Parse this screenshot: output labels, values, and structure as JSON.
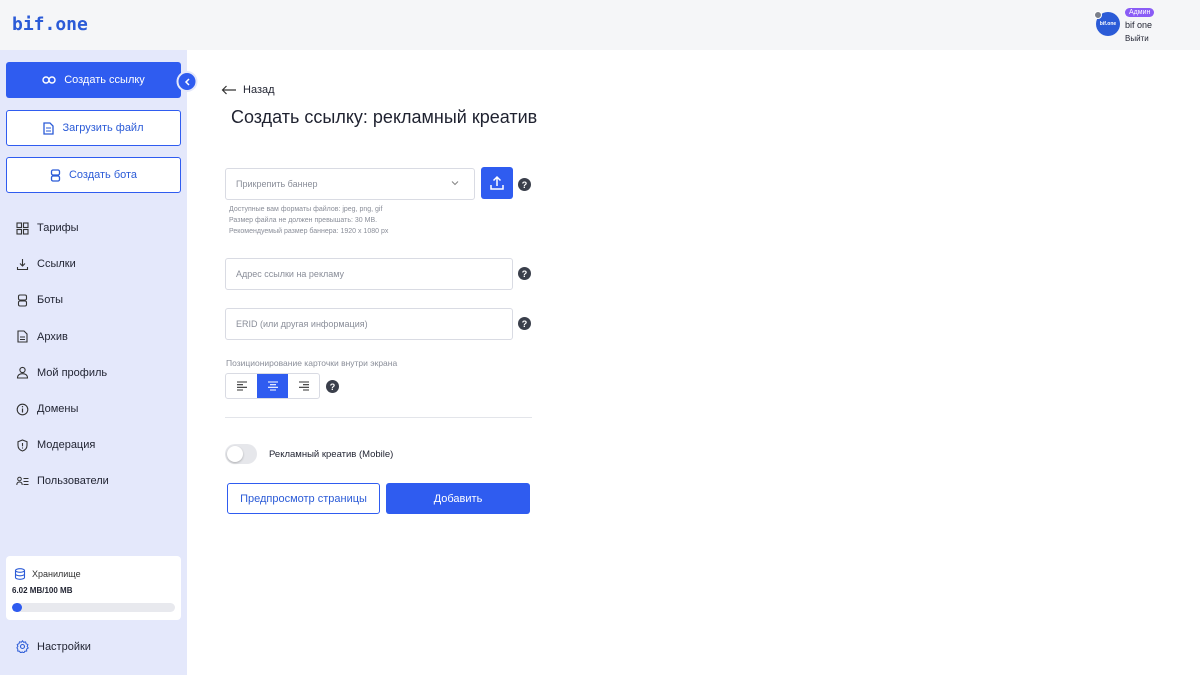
{
  "header": {
    "logo": "bif.one",
    "user": {
      "avatar_text": "bif.one",
      "role": "Админ",
      "name": "bif one",
      "logout": "Выйти"
    }
  },
  "sidebar": {
    "primary_button": "Создать ссылку",
    "upload_button": "Загрузить файл",
    "bot_button": "Создать бота",
    "items": [
      {
        "label": "Тарифы",
        "icon": "grid-icon"
      },
      {
        "label": "Ссылки",
        "icon": "link-download-icon"
      },
      {
        "label": "Боты",
        "icon": "bot-icon"
      },
      {
        "label": "Архив",
        "icon": "document-icon"
      },
      {
        "label": "Мой профиль",
        "icon": "user-icon"
      },
      {
        "label": "Домены",
        "icon": "info-icon"
      },
      {
        "label": "Модерация",
        "icon": "shield-icon"
      },
      {
        "label": "Пользователи",
        "icon": "users-list-icon"
      }
    ],
    "storage": {
      "title": "Хранилище",
      "value": "6.02 MB/100 MB",
      "fraction": 0.0602
    },
    "settings": "Настройки"
  },
  "main": {
    "back": "Назад",
    "title": "Создать ссылку: рекламный креатив",
    "banner_select_placeholder": "Прикрепить баннер",
    "hint_lines": [
      "Доступные вам форматы файлов: jpeg, png, gif",
      "Размер файла не должен превышать: 30 MB.",
      "Рекомендуемый размер баннера: 1920 x 1080 px"
    ],
    "ad_url_placeholder": "Адрес ссылки на рекламу",
    "erid_placeholder": "ERID (или другая информация)",
    "positioning_label": "Позиционирование карточки внутри экрана",
    "alignment_selected": "center",
    "toggle_label": "Рекламный креатив (Mobile)",
    "toggle_on": false,
    "preview_button": "Предпросмотр страницы",
    "add_button": "Добавить",
    "help_glyph": "?"
  },
  "colors": {
    "accent": "#2f5cf0",
    "sidebar_bg": "#e4e8fb",
    "header_bg": "#f5f6f8",
    "role_badge": "#8a5cf6"
  }
}
